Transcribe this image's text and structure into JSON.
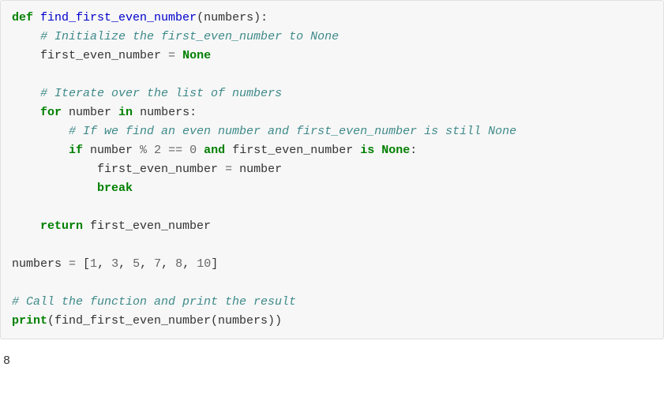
{
  "code": {
    "l1_kw_def": "def",
    "l1_fn": "find_first_even_number",
    "l1_open": "(numbers):",
    "l2_comment": "# Initialize the first_even_number to None",
    "l3_var": "first_even_number ",
    "l3_op": "=",
    "l3_sp": " ",
    "l3_none": "None",
    "l5_comment": "# Iterate over the list of numbers",
    "l6_for": "for",
    "l6_mid": " number ",
    "l6_in": "in",
    "l6_end": " numbers:",
    "l7_comment": "# If we find an even number and first_even_number is still None",
    "l8_if": "if",
    "l8_a": " number ",
    "l8_mod": "%",
    "l8_sp1": " ",
    "l8_two": "2",
    "l8_sp2": " ",
    "l8_eq": "==",
    "l8_sp3": " ",
    "l8_zero": "0",
    "l8_sp4": " ",
    "l8_and": "and",
    "l8_b": " first_even_number ",
    "l8_is": "is",
    "l8_sp5": " ",
    "l8_none": "None",
    "l8_colon": ":",
    "l9_assign": "first_even_number ",
    "l9_op": "=",
    "l9_end": " number",
    "l10_break": "break",
    "l12_return": "return",
    "l12_end": " first_even_number",
    "l14_a": "numbers ",
    "l14_eq": "=",
    "l14_sp": " [",
    "l14_n1": "1",
    "l14_c1": ", ",
    "l14_n2": "3",
    "l14_c2": ", ",
    "l14_n3": "5",
    "l14_c3": ", ",
    "l14_n4": "7",
    "l14_c4": ", ",
    "l14_n5": "8",
    "l14_c5": ", ",
    "l14_n6": "10",
    "l14_close": "]",
    "l16_comment": "# Call the function and print the result",
    "l17_print": "print",
    "l17_open": "(find_first_even_number(numbers))"
  },
  "output": "8"
}
